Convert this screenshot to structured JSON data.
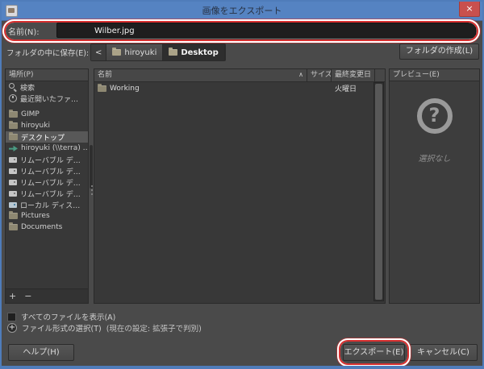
{
  "window": {
    "title": "画像をエクスポート",
    "close_label": "×"
  },
  "name_row": {
    "label": "名前(N):",
    "value": "Wilber.jpg"
  },
  "folder_row": {
    "label": "フォルダの中に保存(E):",
    "back": "<",
    "breadcrumbs": [
      {
        "label": "hiroyuki",
        "active": false
      },
      {
        "label": "Desktop",
        "active": true
      }
    ],
    "create_folder_label": "フォルダの作成(L)"
  },
  "places": {
    "header": "場所(P)",
    "items": [
      {
        "label": "検索",
        "icon": "search-icon"
      },
      {
        "label": "最近開いたファ…",
        "icon": "recent-icon"
      },
      {
        "label": "GIMP",
        "icon": "folder-icon"
      },
      {
        "label": "hiroyuki",
        "icon": "folder-icon"
      },
      {
        "label": "デスクトップ",
        "icon": "folder-icon",
        "selected": true
      },
      {
        "label": "hiroyuki (\\\\terra) …",
        "icon": "network-icon"
      },
      {
        "label": "リムーバブル デ…",
        "icon": "drive-icon"
      },
      {
        "label": "リムーバブル デ…",
        "icon": "drive-icon"
      },
      {
        "label": "リムーバブル デ…",
        "icon": "drive-icon"
      },
      {
        "label": "リムーバブル デ…",
        "icon": "drive-icon"
      },
      {
        "label": "ローカル ディス…",
        "icon": "disk-icon"
      },
      {
        "label": "Pictures",
        "icon": "folder-icon"
      },
      {
        "label": "Documents",
        "icon": "folder-icon"
      }
    ],
    "add_label": "+",
    "remove_label": "−"
  },
  "file_list": {
    "columns": {
      "name": "名前",
      "size": "サイズ",
      "modified": "最終変更日"
    },
    "sort_indicator": "∧",
    "rows": [
      {
        "name": "Working",
        "size": "",
        "modified": "火曜日"
      }
    ]
  },
  "preview": {
    "header": "プレビュー(E)",
    "icon": "question-icon",
    "empty_text": "選択なし"
  },
  "options": {
    "show_all_files": "すべてのファイルを表示(A)",
    "file_type_label": "ファイル形式の選択(T)",
    "file_type_note": "(現在の設定: 拡張子で判別)"
  },
  "actions": {
    "help": "ヘルプ(H)",
    "export": "エクスポート(E)",
    "cancel": "キャンセル(C)"
  },
  "colors": {
    "titlebar": "#5583c2",
    "window_border": "#4f7cba",
    "close_button": "#c9504e",
    "dialog_bg": "#4a4a4a",
    "panel_bg": "#383838",
    "entry_bg": "#1e1e1e",
    "annotation_red": "#d83030",
    "annotation_white": "#ffffff",
    "selection_bg": "#585858"
  }
}
